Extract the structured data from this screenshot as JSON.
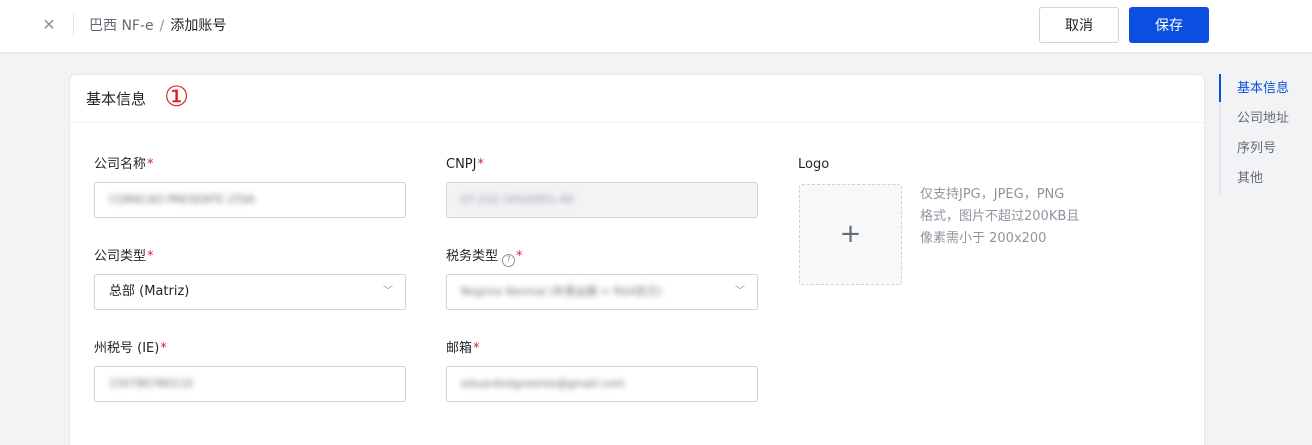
{
  "header": {
    "breadcrumb_parent": "巴西 NF-e",
    "breadcrumb_sep": "/",
    "breadcrumb_current": "添加账号",
    "cancel_label": "取消",
    "save_label": "保存",
    "close_icon": "close-icon",
    "close_glyph": "✕"
  },
  "section": {
    "title": "基本信息",
    "step_mark": "①"
  },
  "form": {
    "company_name": {
      "label": "公司名称",
      "required": "*",
      "value": "CORACAO PRESENTE LTDA"
    },
    "cnpj": {
      "label": "CNPJ",
      "required": "*",
      "value": "07.222.345/0001-40"
    },
    "company_type": {
      "label": "公司类型",
      "required": "*",
      "value": "总部 (Matriz)"
    },
    "tax_type": {
      "label": "税务类型",
      "required": "*",
      "value": "Regime Normal (年营业额 > R$4百万)"
    },
    "state_tax_id": {
      "label": "州税号 (IE)",
      "required": "*",
      "value": "150780780110"
    },
    "email": {
      "label": "邮箱",
      "required": "*",
      "value": "eduardodgreente@gmail.com"
    },
    "logo": {
      "label": "Logo",
      "plus": "+",
      "hint_line1": "仅支持JPG，JPEG，PNG",
      "hint_line2": "格式，图片不超过200KB且",
      "hint_line3": "像素需小于 200x200"
    }
  },
  "anchor_nav": {
    "items": [
      {
        "label": "基本信息",
        "active": true
      },
      {
        "label": "公司地址",
        "active": false
      },
      {
        "label": "序列号",
        "active": false
      },
      {
        "label": "其他",
        "active": false
      }
    ]
  },
  "colors": {
    "primary": "#0b4fe0",
    "required": "#d4262f",
    "step_mark": "#e02020"
  }
}
